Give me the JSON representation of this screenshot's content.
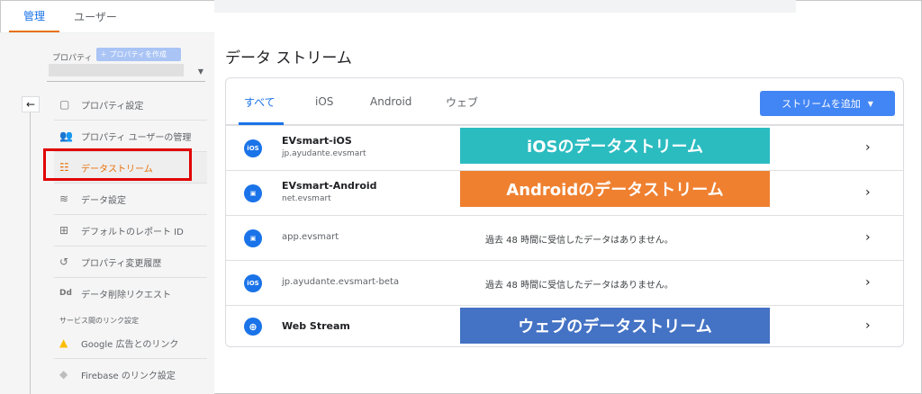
{
  "top_tabs": {
    "admin": "管理",
    "user": "ユーザー"
  },
  "sidebar": {
    "property_label": "プロパティ",
    "create_property": "＋ プロパティを作成",
    "back": "←",
    "items": [
      {
        "icon": "property-settings-icon",
        "glyph": "▢",
        "label": "プロパティ設定"
      },
      {
        "icon": "people-icon",
        "glyph": "👥",
        "label": "プロパティ ユーザーの管理"
      },
      {
        "icon": "data-streams-icon",
        "glyph": "☷",
        "label": "データストリーム"
      },
      {
        "icon": "database-icon",
        "glyph": "≋",
        "label": "データ設定"
      },
      {
        "icon": "report-id-icon",
        "glyph": "⊞",
        "label": "デフォルトのレポート ID"
      },
      {
        "icon": "history-icon",
        "glyph": "↺",
        "label": "プロパティ変更履歴"
      },
      {
        "icon": "data-deletion-icon",
        "glyph": "Dd",
        "label": "データ削除リクエスト"
      }
    ],
    "links_section": "サービス間のリンク設定",
    "links": [
      {
        "icon": "google-ads-icon",
        "glyph": "▲",
        "label": "Google 広告とのリンク"
      },
      {
        "icon": "firebase-icon",
        "glyph": "◆",
        "label": "Firebase のリンク設定"
      }
    ]
  },
  "main": {
    "title": "データ ストリーム",
    "tabs": [
      "すべて",
      "iOS",
      "Android",
      "ウェブ"
    ],
    "add_button": "ストリームを追加",
    "rows": [
      {
        "platform": "iOS",
        "name": "EVsmart-iOS",
        "sub": "jp.ayudante.evsmart",
        "message": ""
      },
      {
        "platform": "Android",
        "name": "EVsmart-Android",
        "sub": "net.evsmart",
        "message": ""
      },
      {
        "platform": "Android",
        "name": "app.evsmart",
        "sub": "",
        "message": "過去 48 時間に受信したデータはありません。"
      },
      {
        "platform": "iOS",
        "name": "jp.ayudante.evsmart-beta",
        "sub": "",
        "message": "過去 48 時間に受信したデータはありません。"
      },
      {
        "platform": "Web",
        "name": "Web Stream",
        "sub": "",
        "message": ""
      }
    ]
  },
  "annotations": {
    "ios": "iOSのデータストリーム",
    "android": "Androidのデータストリーム",
    "web": "ウェブのデータストリーム"
  },
  "colors": {
    "accent_blue": "#1a73e8",
    "active_orange": "#e8710a",
    "highlight_red": "#e00000",
    "ios_annotation": "#2bbcc0",
    "android_annotation": "#ef8030",
    "web_annotation": "#4472c4"
  }
}
